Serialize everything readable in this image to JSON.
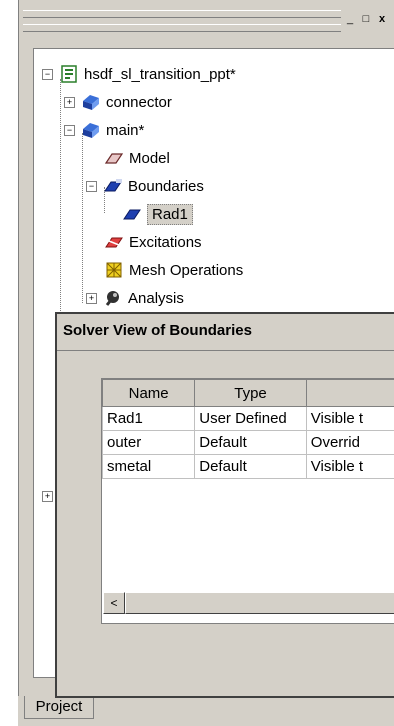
{
  "window": {
    "min_btn": "_",
    "max_btn": "□",
    "close_btn": "x"
  },
  "tree": {
    "root": "hsdf_sl_transition_ppt*",
    "items": [
      {
        "label": "connector",
        "expander": "+"
      },
      {
        "label": "main*",
        "expander": "−"
      },
      {
        "label": "Model"
      },
      {
        "label": "Boundaries",
        "expander": "−"
      },
      {
        "label": "Rad1"
      },
      {
        "label": "Excitations"
      },
      {
        "label": "Mesh Operations"
      },
      {
        "label": "Analysis",
        "expander": "+"
      }
    ],
    "root_expander": "−",
    "lower_expander": "+"
  },
  "tabs": {
    "project": "Project"
  },
  "dialog": {
    "title": "Solver View of Boundaries",
    "columns": [
      "Name",
      "Type",
      ""
    ],
    "rows": [
      [
        "Rad1",
        "User Defined",
        "Visible t"
      ],
      [
        "outer",
        "Default",
        "Overrid"
      ],
      [
        "smetal",
        "Default",
        "Visible t"
      ]
    ],
    "scroll_left": "<"
  }
}
